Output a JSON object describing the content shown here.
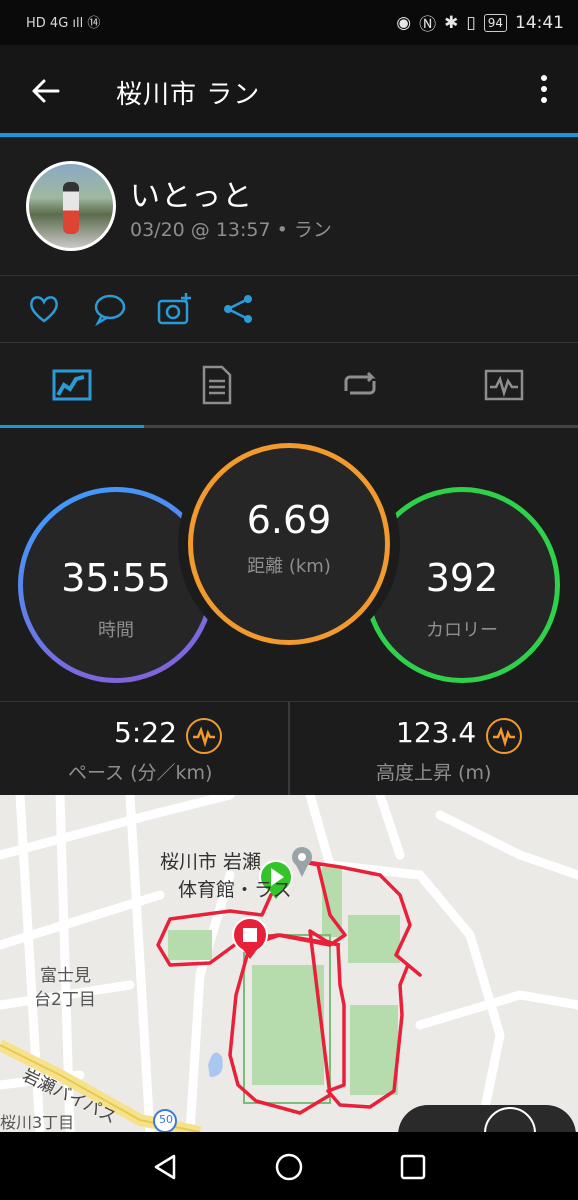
{
  "status": {
    "left_icons": "HD 4G ıll ⑭",
    "battery": "94",
    "time": "14:41"
  },
  "appbar": {
    "title": "桜川市 ラン"
  },
  "profile": {
    "name": "いとっと",
    "meta": "03/20 @ 13:57 • ラン"
  },
  "actions": [
    "heart-icon",
    "comment-icon",
    "camera-add-icon",
    "share-icon"
  ],
  "tabs": [
    "summary-tab",
    "details-tab",
    "laps-tab",
    "charts-tab"
  ],
  "stats": {
    "time": {
      "value": "35:55",
      "label": "時間"
    },
    "distance": {
      "value": "6.69",
      "label": "距離 (km)"
    },
    "calories": {
      "value": "392",
      "label": "カロリー"
    }
  },
  "metrics": {
    "pace": {
      "value": "5:22",
      "label": "ペース (分／km)"
    },
    "elevation": {
      "value": "123.4",
      "label": "高度上昇 (m)"
    }
  },
  "map": {
    "place_label_1": "桜川市 岩瀬",
    "place_label_2": "体育館・ラス",
    "area_label_1": "富士見",
    "area_label_2": "台2丁目",
    "road_label": "岩瀬バイパス",
    "road_number": "50",
    "district_label": "桜川3丁目"
  },
  "colors": {
    "accent": "#1a97d6",
    "time_ring": "#5b8fe0",
    "distance_ring": "#f29a2e",
    "calories_ring": "#2fd14a",
    "route": "#e8203a",
    "start_pin": "#33c42a",
    "end_pin": "#e8203a"
  }
}
